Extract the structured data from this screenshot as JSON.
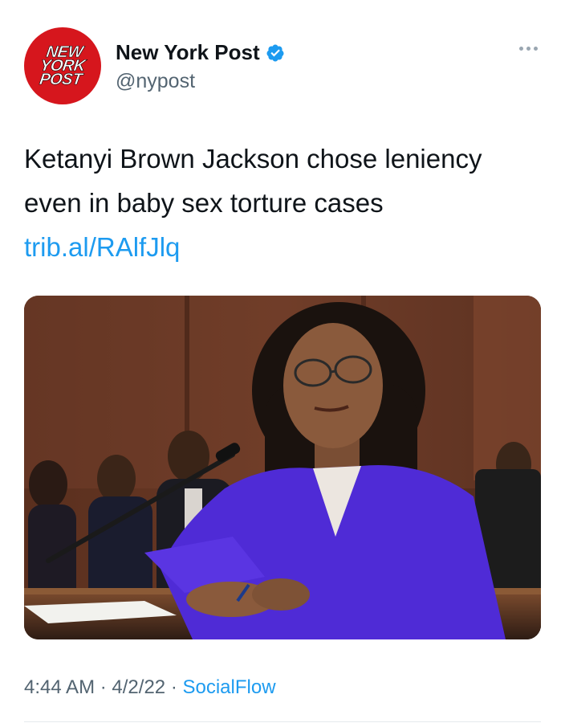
{
  "tweet": {
    "avatar_text": [
      "NEW",
      "YORK",
      "POST"
    ],
    "display_name": "New York Post",
    "handle": "@nypost",
    "text": "Ketanyi Brown Jackson chose leniency even in baby sex torture cases",
    "link": "trib.al/RAlfJlq",
    "time": "4:44 AM",
    "date": "4/2/22",
    "separator": "·",
    "source": "SocialFlow"
  },
  "colors": {
    "accent": "#1d9bf0",
    "brand_red": "#d6161d",
    "blazer": "#4f2bd6"
  },
  "icons": {
    "verified": "verified-badge-icon",
    "more": "more-options-icon"
  }
}
